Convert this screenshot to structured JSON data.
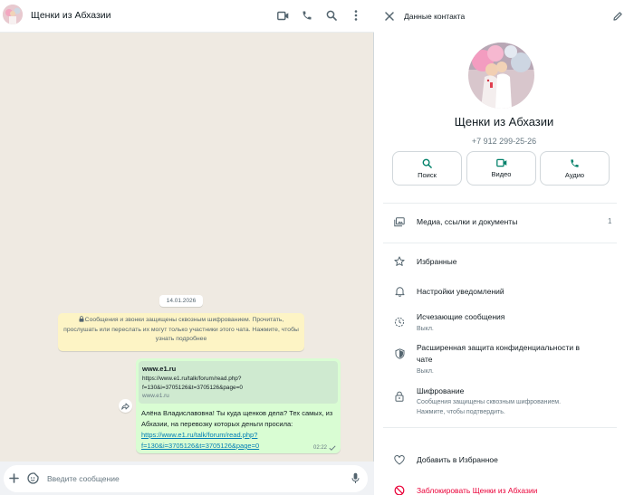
{
  "chat": {
    "title": "Щенки из Абхазии",
    "header_icons": [
      "video-call-icon",
      "phone-icon",
      "search-icon",
      "menu-icon"
    ],
    "date_chip": "14.01.2026",
    "encryption_notice": "Сообщения и звонки защищены сквозным шифрованием. Прочитать, прослушать или переслать их могут только участники этого чата. Нажмите, чтобы узнать подробнее",
    "message": {
      "preview_title": "www.e1.ru",
      "preview_url_line1": "https://www.e1.ru/talk/forum/read.php?",
      "preview_url_line2": "f=130&i=3705126&t=3705126&page=0",
      "preview_domain": "www.e1.ru",
      "text": "Алёна Владиславовна! Ты куда щенков дела? Тех самых, из Абхазии, на перевозку которых деньги просила: ",
      "link": "https://www.e1.ru/talk/forum/read.php?f=130&i=3705126&t=3705126&page=0",
      "time": "02:22"
    },
    "composer_placeholder": "Введите сообщение"
  },
  "contact": {
    "header_title": "Данные контакта",
    "name": "Щенки из Абхазии",
    "phone": "+7 912 299-25-26",
    "actions": [
      {
        "label": "Поиск",
        "icon": "search-icon"
      },
      {
        "label": "Видео",
        "icon": "video-icon"
      },
      {
        "label": "Аудио",
        "icon": "phone-icon"
      }
    ],
    "media_label": "Медиа, ссылки и документы",
    "media_count": "1",
    "favorites_label": "Избранные",
    "notifications_label": "Настройки уведомлений",
    "disappearing_label": "Исчезающие сообщения",
    "disappearing_sub": "Выкл.",
    "privacy_label_1": "Расширенная защита конфиденциальности в",
    "privacy_label_2": "чате",
    "privacy_sub": "Выкл.",
    "encryption_label": "Шифрование",
    "encryption_sub_1": "Сообщения защищены сквозным шифрованием.",
    "encryption_sub_2": "Нажмите, чтобы подтвердить.",
    "add_favorite_label": "Добавить в Избранное",
    "block_label": "Заблокировать Щенки из Абхазии"
  },
  "colors": {
    "accent_green": "#008069",
    "bubble_green": "#d9fdd3",
    "chat_bg": "#efeae2",
    "danger": "#ea0038"
  }
}
